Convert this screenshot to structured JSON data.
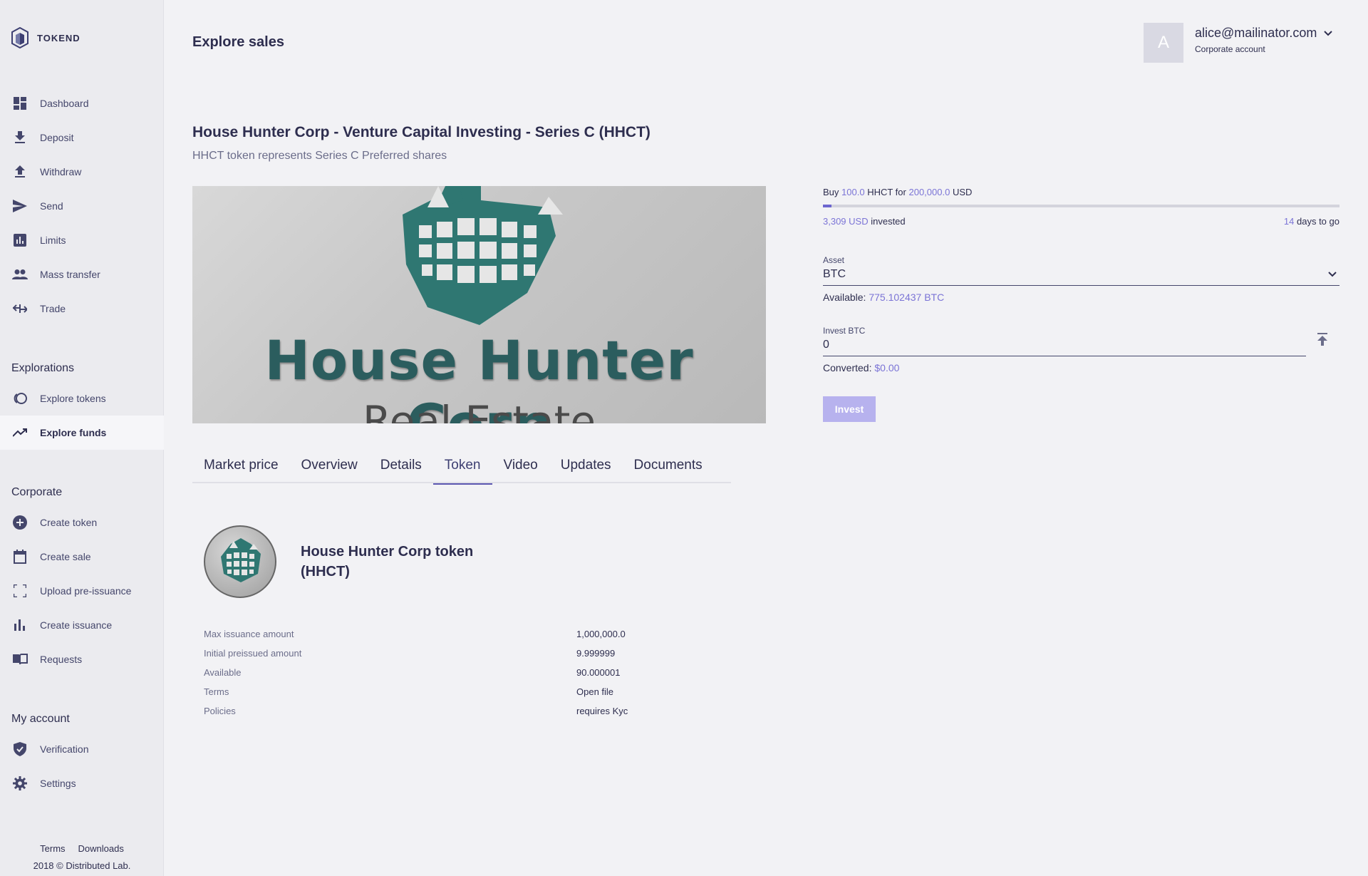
{
  "sidebar": {
    "logo_text": "TOKEND",
    "main_items": [
      {
        "label": "Dashboard",
        "icon": "dashboard-icon"
      },
      {
        "label": "Deposit",
        "icon": "download-icon"
      },
      {
        "label": "Withdraw",
        "icon": "upload-icon"
      },
      {
        "label": "Send",
        "icon": "send-icon"
      },
      {
        "label": "Limits",
        "icon": "chart-icon"
      },
      {
        "label": "Mass transfer",
        "icon": "people-icon"
      },
      {
        "label": "Trade",
        "icon": "trade-icon"
      }
    ],
    "explorations_title": "Explorations",
    "explorations": [
      {
        "label": "Explore tokens",
        "icon": "tokens-icon"
      },
      {
        "label": "Explore funds",
        "icon": "trending-icon",
        "active": true
      }
    ],
    "corporate_title": "Corporate",
    "corporate": [
      {
        "label": "Create token",
        "icon": "plus-circle-icon"
      },
      {
        "label": "Create sale",
        "icon": "calendar-icon"
      },
      {
        "label": "Upload pre-issuance",
        "icon": "expand-icon"
      },
      {
        "label": "Create issuance",
        "icon": "bar-chart-icon"
      },
      {
        "label": "Requests",
        "icon": "book-icon"
      }
    ],
    "account_title": "My account",
    "account": [
      {
        "label": "Verification",
        "icon": "shield-check-icon"
      },
      {
        "label": "Settings",
        "icon": "gear-icon"
      }
    ],
    "footer": {
      "terms": "Terms",
      "downloads": "Downloads",
      "copyright": "2018 © Distributed Lab."
    }
  },
  "header": {
    "title": "Explore sales",
    "avatar_letter": "A",
    "email": "alice@mailinator.com",
    "account_type": "Corporate account"
  },
  "sale": {
    "title": "House Hunter Corp - Venture Capital Investing - Series C (HHCT)",
    "subtitle": "HHCT token represents Series C Preferred shares",
    "image_text_main": "House Hunter Corp",
    "image_text_sub": "Real Estate"
  },
  "tabs": [
    {
      "label": "Market price"
    },
    {
      "label": "Overview"
    },
    {
      "label": "Details"
    },
    {
      "label": "Token",
      "active": true
    },
    {
      "label": "Video"
    },
    {
      "label": "Updates"
    },
    {
      "label": "Documents"
    }
  ],
  "token": {
    "name": "House Hunter Corp token (HHCT)",
    "details": [
      {
        "key": "Max issuance amount",
        "value": "1,000,000.0"
      },
      {
        "key": "Initial preissued amount",
        "value": "9.999999"
      },
      {
        "key": "Available",
        "value": "90.000001"
      },
      {
        "key": "Terms",
        "value": "Open file"
      },
      {
        "key": "Policies",
        "value": "requires Kyc"
      }
    ]
  },
  "invest": {
    "buy_prefix": "Buy",
    "buy_amount": "100.0",
    "buy_mid": "HHCT for",
    "buy_price": "200,000.0",
    "buy_currency": "USD",
    "progress_fraction": 0.0165,
    "invested_amount": "3,309 USD",
    "invested_suffix": "invested",
    "days": "14",
    "days_suffix": "days to go",
    "asset_label": "Asset",
    "asset_value": "BTC",
    "available_label": "Available:",
    "available_value": "775.102437 BTC",
    "invest_label": "Invest BTC",
    "invest_value": "0",
    "converted_label": "Converted:",
    "converted_value": "$0.00",
    "button_label": "Invest"
  },
  "colors": {
    "accent": "#7b74d6",
    "button": "#b7b2ee",
    "text": "#2e2e4f",
    "teal": "#2b5d5e"
  }
}
